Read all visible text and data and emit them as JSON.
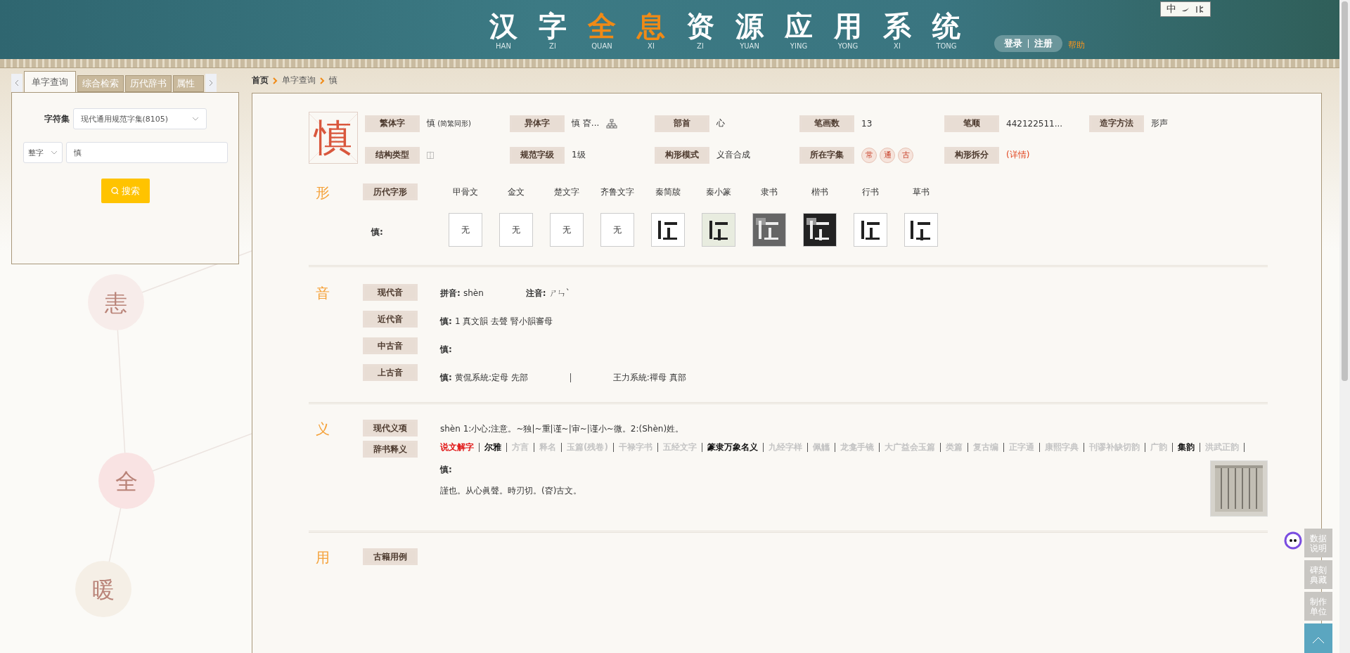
{
  "header": {
    "title": [
      {
        "char": "汉",
        "pinyin": "HAN",
        "highlight": false
      },
      {
        "char": "字",
        "pinyin": "ZI",
        "highlight": false
      },
      {
        "char": "全",
        "pinyin": "QUAN",
        "highlight": true
      },
      {
        "char": "息",
        "pinyin": "XI",
        "highlight": true
      },
      {
        "char": "资",
        "pinyin": "ZI",
        "highlight": false
      },
      {
        "char": "源",
        "pinyin": "YUAN",
        "highlight": false
      },
      {
        "char": "应",
        "pinyin": "YING",
        "highlight": false
      },
      {
        "char": "用",
        "pinyin": "YONG",
        "highlight": false
      },
      {
        "char": "系",
        "pinyin": "XI",
        "highlight": false
      },
      {
        "char": "统",
        "pinyin": "TONG",
        "highlight": false
      }
    ],
    "login": "登录",
    "register": "注册",
    "help": "帮助",
    "lang": "中"
  },
  "background_graph": {
    "nodes": [
      "恚",
      "全",
      "暖"
    ]
  },
  "search_panel": {
    "tabs": [
      {
        "label": "单字查询",
        "selected": true
      },
      {
        "label": "综合检索",
        "selected": false
      },
      {
        "label": "历代辞书",
        "selected": false
      },
      {
        "label": "属性",
        "selected": false
      }
    ],
    "charset_label": "字符集",
    "charset": "现代通用规范字集(8105)",
    "mode": "整字",
    "query": "慎",
    "search_button": "搜索"
  },
  "breadcrumb": [
    "首页",
    "单字查询",
    "慎"
  ],
  "entry": {
    "char": "慎",
    "fields": [
      {
        "label": "繁体字",
        "kind": "text",
        "value": "慎",
        "note": "(简繁同形)"
      },
      {
        "label": "异体字",
        "kind": "tree",
        "value": "慎 昚..."
      },
      {
        "label": "部首",
        "kind": "text",
        "value": "心"
      },
      {
        "label": "笔画数",
        "kind": "text",
        "value": "13"
      },
      {
        "label": "笔顺",
        "kind": "text",
        "value": "442122511..."
      },
      {
        "label": "造字方法",
        "kind": "text",
        "value": "形声"
      },
      {
        "label": "结构类型",
        "kind": "structure"
      },
      {
        "label": "规范字级",
        "kind": "text",
        "value": "1级"
      },
      {
        "label": "构形模式",
        "kind": "text",
        "value": "义音合成"
      },
      {
        "label": "所在字集",
        "kind": "stamps",
        "stamps": [
          "常",
          "通",
          "古"
        ]
      },
      {
        "label": "构形拆分",
        "kind": "link",
        "value": "(详情)"
      }
    ]
  },
  "sections": [
    {
      "title": "形",
      "kind": "forms",
      "label": "历代字形",
      "row_label": "慎:",
      "forms": [
        {
          "script": "甲骨文",
          "kind": "none",
          "text": "无"
        },
        {
          "script": "金文",
          "kind": "none",
          "text": "无"
        },
        {
          "script": "楚文字",
          "kind": "none",
          "text": "无"
        },
        {
          "script": "齐鲁文字",
          "kind": "none",
          "text": "无"
        },
        {
          "script": "秦简牍",
          "kind": "picture"
        },
        {
          "script": "秦小篆",
          "kind": "picture"
        },
        {
          "script": "隶书",
          "kind": "picture"
        },
        {
          "script": "楷书",
          "kind": "picture"
        },
        {
          "script": "行书",
          "kind": "picture"
        },
        {
          "script": "草书",
          "kind": "picture"
        }
      ]
    },
    {
      "title": "音",
      "kind": "sounds",
      "rows": [
        {
          "label": "现代音",
          "parts": [
            {
              "key": "拼音:",
              "value": "shèn"
            },
            {
              "key": "注音:",
              "value": "ㄕㄣˋ"
            }
          ]
        },
        {
          "label": "近代音",
          "parts": [
            {
              "key": "慎:",
              "value": "1 真文韻 去聲 腎小韻審母"
            }
          ]
        },
        {
          "label": "中古音",
          "parts": [
            {
              "key": "慎:"
            }
          ]
        },
        {
          "label": "上古音",
          "parts": [
            {
              "key": "慎:",
              "value": "黄侃系統:定母 先部"
            },
            {
              "value": "王力系統:禪母 真部"
            }
          ]
        }
      ]
    },
    {
      "title": "义",
      "kind": "meanings",
      "modern_label": "现代义项",
      "modern": "shèn 1:小心;注意。~独|~重|谨~|审~|谨小~微。2:(Shèn)姓。",
      "dict_label": "辞书释义",
      "dictionaries": [
        {
          "name": "说文解字",
          "selected": true,
          "available": true
        },
        {
          "name": "尔雅",
          "selected": false,
          "available": true
        },
        {
          "name": "方言",
          "selected": false,
          "available": false
        },
        {
          "name": "释名",
          "selected": false,
          "available": false
        },
        {
          "name": "玉篇(残卷)",
          "selected": false,
          "available": false
        },
        {
          "name": "干禄字书",
          "selected": false,
          "available": false
        },
        {
          "name": "五经文字",
          "selected": false,
          "available": false
        },
        {
          "name": "篆隶万象名义",
          "selected": false,
          "available": true
        },
        {
          "name": "九经字样",
          "selected": false,
          "available": false
        },
        {
          "name": "佩觿",
          "selected": false,
          "available": false
        },
        {
          "name": "龙龛手镜",
          "selected": false,
          "available": false
        },
        {
          "name": "大广益会玉篇",
          "selected": false,
          "available": false
        },
        {
          "name": "类篇",
          "selected": false,
          "available": false
        },
        {
          "name": "复古编",
          "selected": false,
          "available": false
        },
        {
          "name": "正字通",
          "selected": false,
          "available": false
        },
        {
          "name": "康熙字典",
          "selected": false,
          "available": false
        },
        {
          "name": "刊谬补缺切韵",
          "selected": false,
          "available": false
        },
        {
          "name": "广韵",
          "selected": false,
          "available": false
        },
        {
          "name": "集韵",
          "selected": false,
          "available": true
        },
        {
          "name": "洪武正韵",
          "selected": false,
          "available": false
        }
      ],
      "head": "慎:",
      "definition": "謹也。从心眞聲。時刃切。(昚)古文。"
    },
    {
      "title": "用",
      "kind": "usage",
      "label": "古籍用例"
    }
  ],
  "side_buttons": [
    "数据说明",
    "碑刻典藏",
    "制作单位"
  ]
}
